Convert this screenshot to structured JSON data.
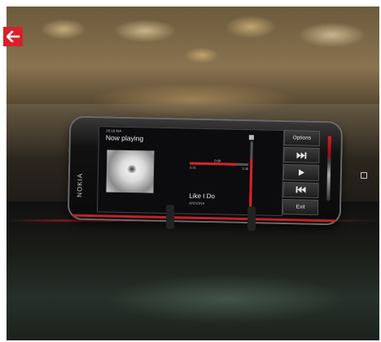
{
  "nav": {
    "back_icon": "arrow-left-icon",
    "accent": "#d8202a"
  },
  "phone": {
    "brand": "NOKIA",
    "screen": {
      "status_time": "16:18 MA",
      "title": "Now playing",
      "track_position": "0:09",
      "elapsed": "0:31",
      "total": "3:48",
      "progress_fraction": 0.8,
      "volume_fraction": 0.75,
      "song_title": "Like I Do",
      "artist": "ANNONA",
      "softkeys": {
        "options": "Options",
        "next_icon": "skip-forward-icon",
        "play_icon": "play-icon",
        "prev_icon": "skip-back-icon",
        "exit": "Exit"
      }
    }
  }
}
